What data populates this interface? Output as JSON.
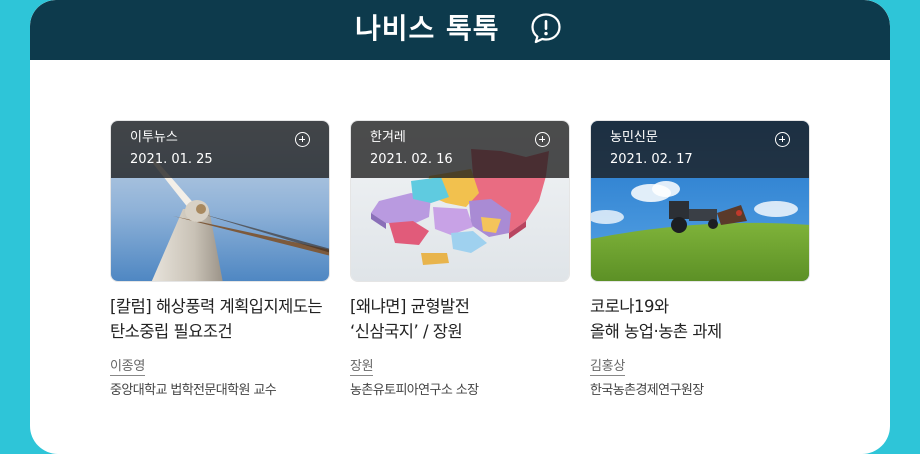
{
  "header": {
    "title": "나비스 톡톡",
    "icon": "speech-bubble-exclamation-icon"
  },
  "colors": {
    "background": "#2ec5d8",
    "header": "#0d3a4c",
    "panel": "#ffffff"
  },
  "cards": [
    {
      "source": "이투뉴스",
      "date": "2021. 01. 25",
      "headline_line1": "[칼럼] 해상풍력 계획입지제도는",
      "headline_line2": "탄소중립 필요조건",
      "author": "이종영",
      "affiliation": "중앙대학교 법학전문대학원 교수",
      "image": "wind-turbine-photo"
    },
    {
      "source": "한겨레",
      "date": "2021. 02. 16",
      "headline_line1": "[왜냐면] 균형발전",
      "headline_line2": "‘신삼국지’ / 장원",
      "author": "장원",
      "affiliation": "농촌유토피아연구소 소장",
      "image": "korea-regional-map-illustration"
    },
    {
      "source": "농민신문",
      "date": "2021. 02. 17",
      "headline_line1": "코로나19와",
      "headline_line2": "올해 농업·농촌 과제",
      "author": "김홍상",
      "affiliation": "한국농촌경제연구원장",
      "image": "tractor-on-field-photo"
    }
  ]
}
